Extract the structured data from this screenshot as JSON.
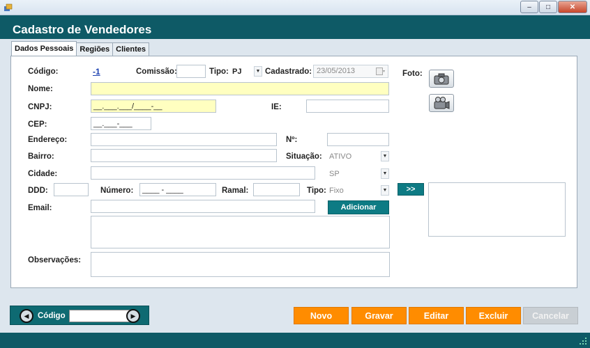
{
  "window": {
    "minimize": "–",
    "maximize": "□",
    "close": "✕"
  },
  "header": {
    "title": "Cadastro de Vendedores"
  },
  "tabs": [
    {
      "label": "Dados Pessoais"
    },
    {
      "label": "Regiões"
    },
    {
      "label": "Clientes"
    }
  ],
  "form": {
    "codigo_label": "Código:",
    "codigo_value": "-1",
    "comissao_label": "Comissão:",
    "comissao_value": "",
    "tipo_label": "Tipo:",
    "tipo_value": "PJ",
    "cadastrado_label": "Cadastrado:",
    "cadastrado_value": "23/05/2013",
    "foto_label": "Foto:",
    "nome_label": "Nome:",
    "nome_value": "",
    "cnpj_label": "CNPJ:",
    "cnpj_mask": "__.___.___/____-__",
    "ie_label": "IE:",
    "ie_value": "",
    "cep_label": "CEP:",
    "cep_mask": "__.___-___",
    "endereco_label": "Endereço:",
    "endereco_value": "",
    "numero_end_label": "Nº:",
    "numero_end_value": "",
    "bairro_label": "Bairro:",
    "bairro_value": "",
    "situacao_label": "Situação:",
    "situacao_value": "ATIVO",
    "cidade_label": "Cidade:",
    "cidade_value": "",
    "uf_value": "SP",
    "ddd_label": "DDD:",
    "ddd_value": "",
    "numero_label": "Número:",
    "numero_mask": "____ - ____",
    "ramal_label": "Ramal:",
    "ramal_value": "",
    "tipo_fone_label": "Tipo:",
    "tipo_fone_value": "Fixo",
    "email_label": "Email:",
    "email_value": "",
    "adicionar_label": "Adicionar",
    "transfer_label": ">>",
    "observacoes_label": "Observações:"
  },
  "footer": {
    "nav_label": "Código",
    "nav_value": "",
    "buttons": {
      "novo": "Novo",
      "gravar": "Gravar",
      "editar": "Editar",
      "excluir": "Excluir",
      "cancelar": "Cancelar"
    }
  },
  "colors": {
    "header": "#0e5a66",
    "accent_button": "#ff8c00",
    "teal_button": "#0e7b84",
    "required_field": "#ffffc0"
  }
}
